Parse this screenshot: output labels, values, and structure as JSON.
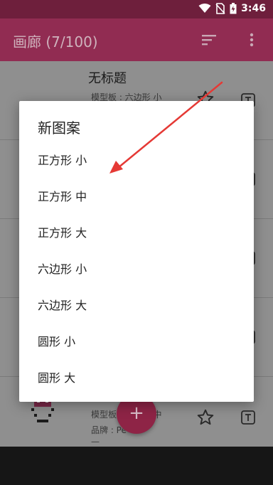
{
  "status_bar": {
    "time": "3:46"
  },
  "app_bar": {
    "title": "画廊 (7/100)",
    "icons": [
      "sort-icon",
      "more-vert-icon"
    ]
  },
  "list_items": [
    {
      "title": "无标题",
      "subtitle": "模型板 : 六边形 小"
    },
    {
      "subtitle": "模型板 : 六边形 中",
      "subtitle2": "品牌 : Pe",
      "subtitle3": "—"
    }
  ],
  "dialog": {
    "title": "新图案",
    "options": [
      "正方形 小",
      "正方形 中",
      "正方形 大",
      "六边形 小",
      "六边形 大",
      "圆形 小",
      "圆形 大"
    ]
  },
  "fab": {
    "label": "+"
  },
  "colors": {
    "status_bar": "#6e1f3c",
    "app_bar": "#912c52",
    "accent": "#8e2446",
    "arrow": "#e53935"
  }
}
